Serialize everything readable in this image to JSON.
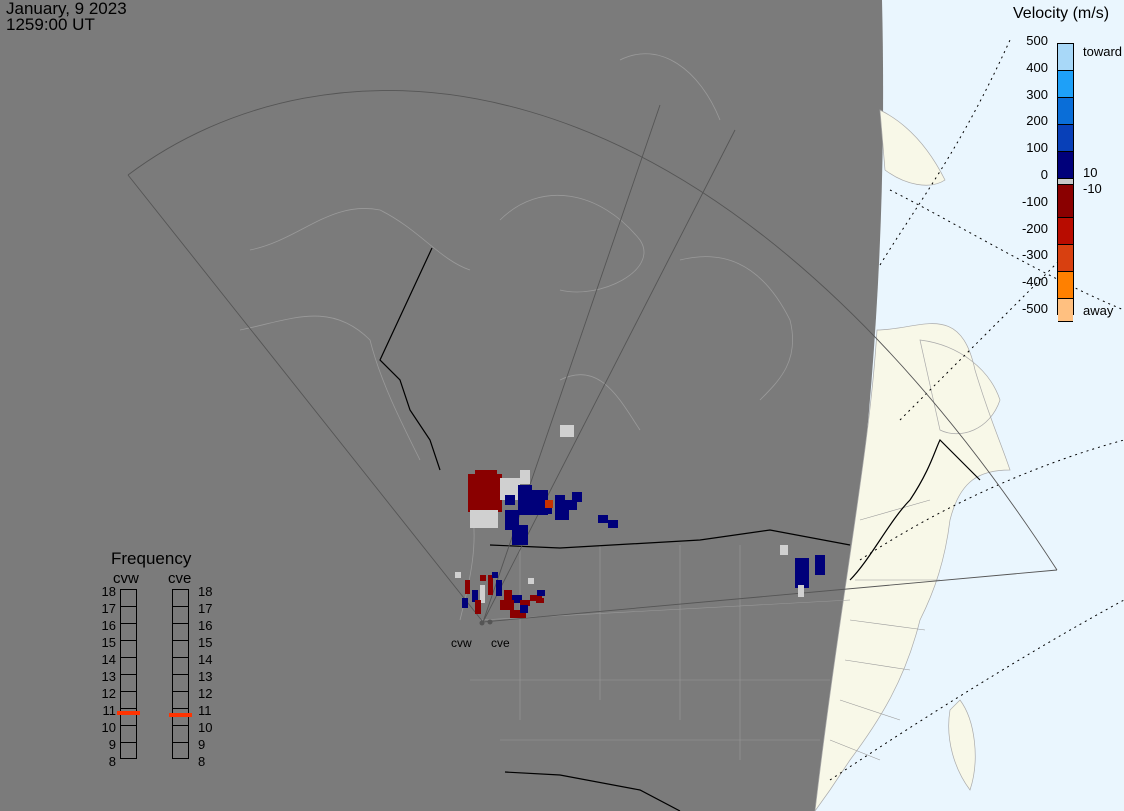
{
  "header": {
    "date": "January, 9 2023",
    "time": "1259:00 UT"
  },
  "velocity_legend": {
    "title": "Velocity (m/s)",
    "ticks": [
      "500",
      "400",
      "300",
      "200",
      "100",
      "0",
      "-100",
      "-200",
      "-300",
      "-400",
      "-500"
    ],
    "toward_label": "toward",
    "away_label": "away",
    "threshold_pos": "10",
    "threshold_neg": "-10",
    "colors": [
      "#a8d8f8",
      "#1ea0f8",
      "#0a6ed8",
      "#0840b8",
      "#00007a",
      "#c8c8c8",
      "#8a0000",
      "#b80c00",
      "#d84010",
      "#ff8000",
      "#ffc080"
    ]
  },
  "frequency_panel": {
    "title": "Frequency",
    "radars": [
      {
        "name": "cvw",
        "freq_mhz": 10.7
      },
      {
        "name": "cve",
        "freq_mhz": 10.6
      }
    ],
    "scale": [
      "18",
      "17",
      "16",
      "15",
      "14",
      "13",
      "12",
      "11",
      "10",
      "9",
      "8"
    ],
    "marker_color": "#ff3300"
  },
  "map": {
    "radar_labels": [
      "cvw",
      "cve"
    ]
  }
}
